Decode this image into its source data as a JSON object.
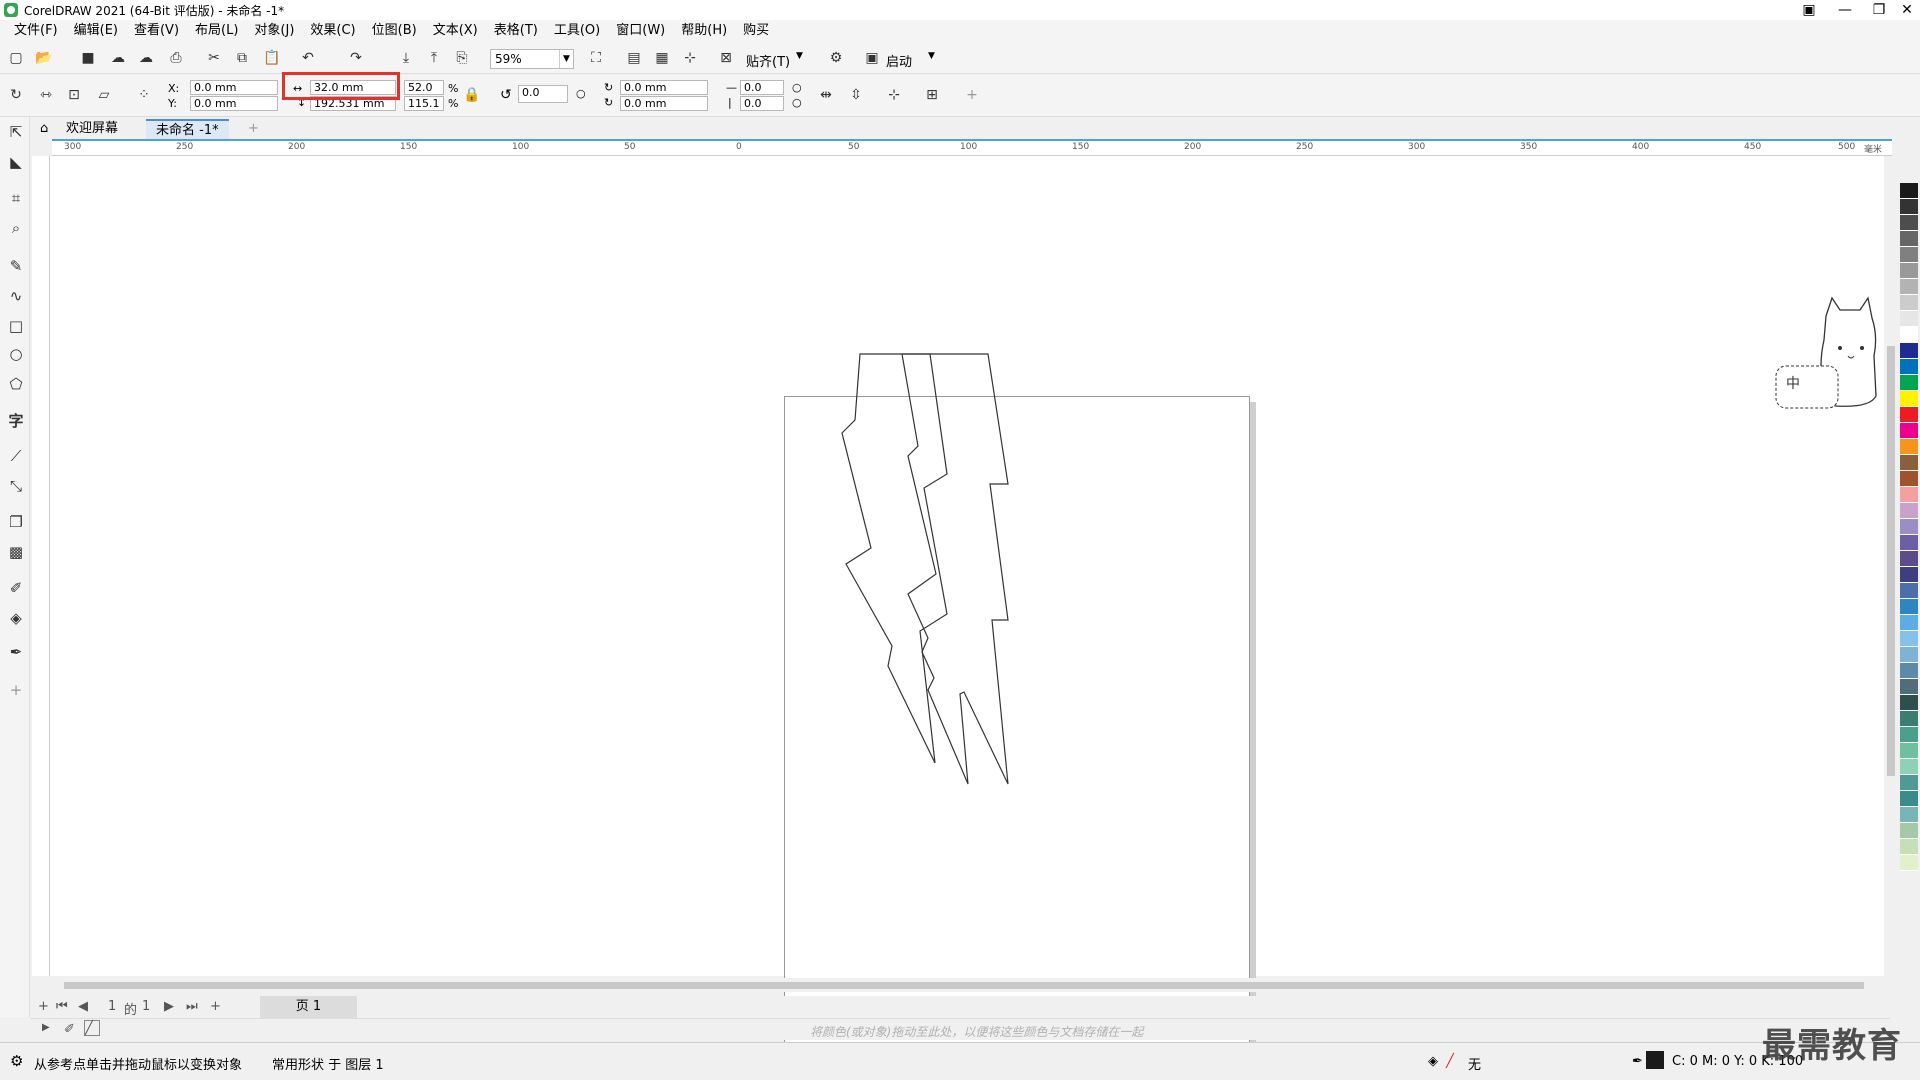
{
  "title": "CorelDRAW 2021 (64-Bit 评估版) - 未命名 -1*",
  "menu": [
    "文件(F)",
    "编辑(E)",
    "查看(V)",
    "布局(L)",
    "对象(J)",
    "效果(C)",
    "位图(B)",
    "文本(X)",
    "表格(T)",
    "工具(O)",
    "窗口(W)",
    "帮助(H)",
    "购买"
  ],
  "toolbar": {
    "zoom": "59%",
    "snap": "贴齐(T)",
    "launch": "启动"
  },
  "props": {
    "x_label": "X:",
    "y_label": "Y:",
    "x": "0.0 mm",
    "y": "0.0 mm",
    "width": "32.0 mm",
    "height": "192.531 mm",
    "scale_w": "52.0",
    "scale_h": "115.1",
    "percent": "%",
    "rotation": "0.0",
    "cx": "0.0 mm",
    "cy": "0.0 mm",
    "outline1": "0.0",
    "outline2": "0.0"
  },
  "tabs": {
    "welcome": "欢迎屏幕",
    "doc": "未命名 -1*"
  },
  "ruler": {
    "h": [
      "300",
      "250",
      "200",
      "150",
      "100",
      "50",
      "0",
      "50",
      "100",
      "150",
      "200",
      "250",
      "300",
      "350",
      "400",
      "450",
      "500"
    ],
    "unit": "毫米"
  },
  "pagenav": {
    "page_num": "1",
    "of": "的",
    "total": "1",
    "page_tab": "页 1"
  },
  "docpal_hint": "将颜色(或对象)拖动至此处，以便将这些颜色与文档存储在一起",
  "status": {
    "hint": "从参考点单击并拖动鼠标以变换对象",
    "layer": "常用形状 于 图层 1",
    "fill": "无",
    "cmyk": "C: 0 M: 0 Y: 0 K: 100"
  },
  "widget": {
    "text": "中"
  },
  "watermark": "最需教育",
  "palette": [
    "#1a1a1a",
    "#333333",
    "#4d4d4d",
    "#666666",
    "#808080",
    "#999999",
    "#b3b3b3",
    "#cccccc",
    "#e6e6e6",
    "#ffffff",
    "#1e2b8f",
    "#0072bc",
    "#00a651",
    "#fff200",
    "#ed1c24",
    "#ec008c",
    "#f7941d",
    "#8b5e3c",
    "#a0522d",
    "#f5a0a0",
    "#c8a2c8",
    "#9b8ec4",
    "#6d5fa5",
    "#5c4d8a",
    "#3f3f7f",
    "#4b6fa8",
    "#2e86c1",
    "#5dade2",
    "#85c1e9",
    "#7fb3d5",
    "#5d8aa8",
    "#4f6d7a",
    "#2f4f4f",
    "#3b7d6e",
    "#4aa08a",
    "#6fbfa0",
    "#8fd1b4",
    "#4f9a94",
    "#3a8c8c",
    "#79b4b7",
    "#a3c9a8",
    "#c5e0b4",
    "#e2f0cb"
  ]
}
